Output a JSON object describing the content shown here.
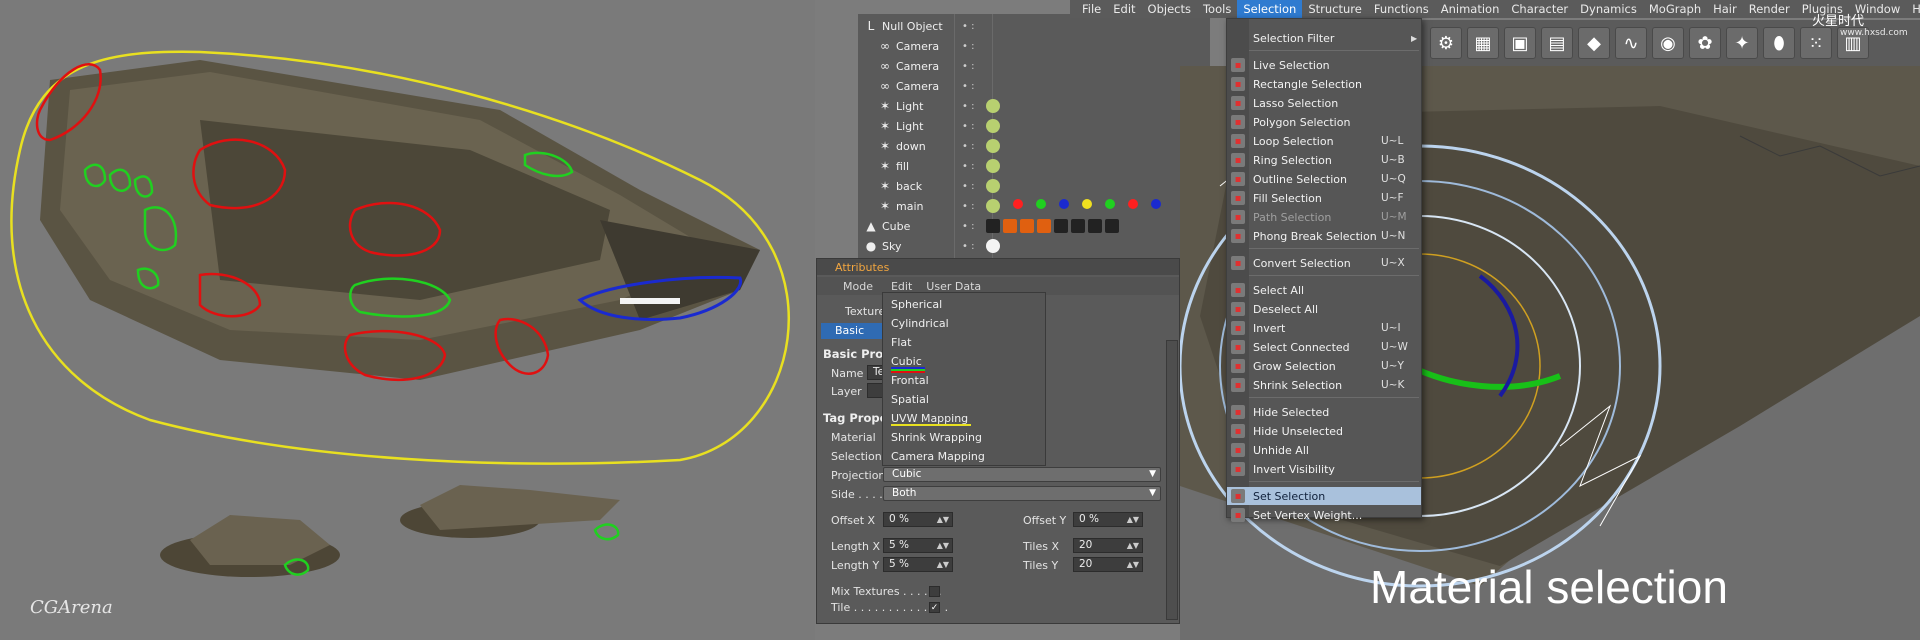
{
  "menu_bar": {
    "items": [
      "File",
      "Edit",
      "Objects",
      "Tools",
      "Selection",
      "Structure",
      "Functions",
      "Animation",
      "Character",
      "Dynamics",
      "MoGraph",
      "Hair",
      "Render",
      "Plugins",
      "Window",
      "Help"
    ],
    "active": "Selection"
  },
  "object_manager": {
    "objects": [
      {
        "name": "Null Object",
        "icon": "null-icon"
      },
      {
        "name": "Camera",
        "icon": "camera-icon"
      },
      {
        "name": "Camera",
        "icon": "camera-icon"
      },
      {
        "name": "Camera",
        "icon": "camera-icon"
      },
      {
        "name": "Light",
        "icon": "light-icon"
      },
      {
        "name": "Light",
        "icon": "light-icon"
      },
      {
        "name": "down",
        "icon": "light-icon"
      },
      {
        "name": "fill",
        "icon": "light-icon"
      },
      {
        "name": "back",
        "icon": "light-icon"
      },
      {
        "name": "main",
        "icon": "light-icon"
      },
      {
        "name": "Cube",
        "icon": "cube-icon"
      },
      {
        "name": "Sky",
        "icon": "sky-icon"
      }
    ]
  },
  "selection_menu": {
    "items": [
      {
        "label": "Selection Filter",
        "key": "",
        "submenu": true
      },
      {
        "label": "Live Selection",
        "key": ""
      },
      {
        "label": "Rectangle Selection",
        "key": ""
      },
      {
        "label": "Lasso Selection",
        "key": ""
      },
      {
        "label": "Polygon Selection",
        "key": ""
      },
      {
        "label": "Loop Selection",
        "key": "U~L"
      },
      {
        "label": "Ring Selection",
        "key": "U~B"
      },
      {
        "label": "Outline Selection",
        "key": "U~Q"
      },
      {
        "label": "Fill Selection",
        "key": "U~F"
      },
      {
        "label": "Path Selection",
        "key": "U~M",
        "disabled": true
      },
      {
        "label": "Phong Break Selection",
        "key": "U~N"
      },
      {
        "label": "Convert Selection",
        "key": "U~X"
      },
      {
        "label": "Select All",
        "key": ""
      },
      {
        "label": "Deselect All",
        "key": ""
      },
      {
        "label": "Invert",
        "key": "U~I"
      },
      {
        "label": "Select Connected",
        "key": "U~W"
      },
      {
        "label": "Grow Selection",
        "key": "U~Y"
      },
      {
        "label": "Shrink Selection",
        "key": "U~K"
      },
      {
        "label": "Hide Selected",
        "key": ""
      },
      {
        "label": "Hide Unselected",
        "key": ""
      },
      {
        "label": "Unhide All",
        "key": ""
      },
      {
        "label": "Invert Visibility",
        "key": ""
      },
      {
        "label": "Set Selection",
        "key": "",
        "highlight": true
      },
      {
        "label": "Set Vertex Weight...",
        "key": ""
      }
    ]
  },
  "attributes": {
    "title": "Attributes",
    "mode_bar": [
      "Mode",
      "Edit",
      "User Data"
    ],
    "object_label": "Texture",
    "basic_tab": "Basic",
    "basic_props": "Basic Prop",
    "name_label": "Name",
    "name_value": "Te",
    "layer_label": "Layer",
    "tag_props": "Tag Proper",
    "material_label": "Material",
    "selection_label": "Selection",
    "projection_label": "Projection",
    "projection_value": "Cubic",
    "side_label": "Side . . . .",
    "side_value": "Both",
    "offset_x_label": "Offset X",
    "offset_x_value": "0 %",
    "offset_y_label": "Offset Y",
    "offset_y_value": "0 %",
    "length_x_label": "Length X",
    "length_x_value": "5 %",
    "length_y_label": "Length Y",
    "length_y_value": "5 %",
    "tiles_x_label": "Tiles X",
    "tiles_x_value": "20",
    "tiles_y_label": "Tiles Y",
    "tiles_y_value": "20",
    "mix_label": "Mix Textures . . . . . .",
    "tile_label": "Tile . . . . . . . . . . . . . .",
    "tile_checked": "✓"
  },
  "projection_options": [
    "Spherical",
    "Cylindrical",
    "Flat",
    "Cubic",
    "Frontal",
    "Spatial",
    "UVW Mapping",
    "Shrink Wrapping",
    "Camera Mapping"
  ],
  "caption": "Material selection",
  "watermark_left": "CGArena",
  "watermark_right": "火星时代",
  "watermark_url": "www.hxsd.com",
  "colors": {
    "menu_active": "#2f7bd0",
    "highlight": "#a9c1dc",
    "outline_yellow": "#e8e020",
    "outline_red": "#e01010",
    "outline_green": "#20d020",
    "outline_blue": "#1a2ad0"
  }
}
